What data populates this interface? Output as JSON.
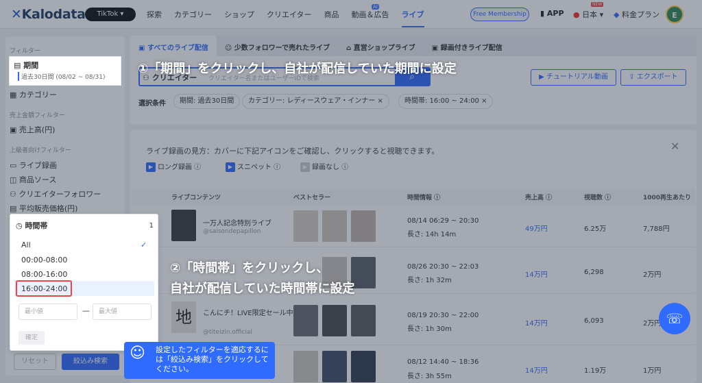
{
  "header": {
    "logo": "Kalodata",
    "platform": "TikTok ▾",
    "nav": [
      "探索",
      "カテゴリー",
      "ショップ",
      "クリエイター",
      "商品",
      "動画＆広告",
      "ライブ"
    ],
    "ai_badge": "AI",
    "free_membership": "Free Membership",
    "app": "APP",
    "language": "日本 ▾",
    "new_badge": "NEW",
    "plan": "料金プラン",
    "avatar": "E"
  },
  "sidebar": {
    "filter_title": "フィルター",
    "period_label": "期間",
    "period_value": "過去30日間 (08/02 ~ 08/31)",
    "category": "カテゴリー",
    "sales_filter_title": "売上金額フィルター",
    "sales": "売上高(円)",
    "advanced_title": "上級者向けフィルター",
    "live_record": "ライブ録画",
    "product_source": "商品ソース",
    "creator_follower": "クリエイターフォロワー",
    "avg_price": "平均販売価格(円)",
    "reset": "リセット",
    "search": "絞込み検索"
  },
  "popup": {
    "title": "時間帯",
    "count": "1",
    "options": [
      "All",
      "00:00-08:00",
      "08:00-16:00",
      "16:00-24:00"
    ],
    "min_placeholder": "最小値",
    "max_placeholder": "最大値",
    "dash": "—",
    "confirm": "確定"
  },
  "tooltip": "設定したフィルターを適応するには「絞込み検索」をクリックしてください。",
  "tabs": [
    "すべてのライブ配信",
    "少数フォロワーで売れたライブ",
    "直営ショップライブ",
    "録画付きライブ配信"
  ],
  "search": {
    "label": "クリエイター",
    "placeholder": "クリエイター名またはユーザーIDで検索",
    "tutorial": "チュートリアル動画",
    "export": "エクスポート"
  },
  "conditions": {
    "label": "選択条件",
    "chips": [
      "期間: 過去30日間",
      "カテゴリー: レディースウェア・インナー ×",
      "時間帯: 16:00 ~ 24:00 ×"
    ]
  },
  "info": {
    "text": "ライブ録画の見方：カバーに下記アイコンをご確認し、クリックすると視聴できます。",
    "legend": [
      "ロング録画 ⓘ",
      "スニペット ⓘ",
      "録画なし ⓘ"
    ]
  },
  "table": {
    "headers": [
      "ライブコンテンツ",
      "ベストセラー",
      "時間情報 ⓘ",
      "売上高 ⓘ",
      "視聴数 ⓘ",
      "1000再生あたり"
    ],
    "rows": [
      {
        "title": "一万人記念特別ライブ",
        "account": "@saisondepapillon",
        "time": "08/14 06:29 ~ 20:30",
        "length": "長さ: 14h 14m",
        "sales": "49万円",
        "views": "6.25万",
        "per": "7,788円"
      },
      {
        "title": "",
        "account": "",
        "time": "08/26 20:30 ~ 22:03",
        "length": "長さ: 1h 32m",
        "sales": "14万円",
        "views": "6,298",
        "per": "2万円"
      },
      {
        "title": "こんにチ！LIVE限定セール中！",
        "account": "@titeizin.official",
        "time": "08/19 20:30 ~ 22:00",
        "length": "長さ: 1h 30m",
        "sales": "14万円",
        "views": "6,093",
        "per": "2万円"
      },
      {
        "title": "",
        "account": "",
        "time": "08/12 14:40 ~ 18:36",
        "length": "長さ: 3h 55m",
        "sales": "14万円",
        "views": "1.19万",
        "per": "1万円"
      }
    ]
  },
  "annotations": {
    "step1": "①「期間」をクリックし、自社が配信していた期間に設定",
    "step2_line1": "②「時間帯」をクリックし、",
    "step2_line2": "自社が配信していた時間帯に設定"
  }
}
